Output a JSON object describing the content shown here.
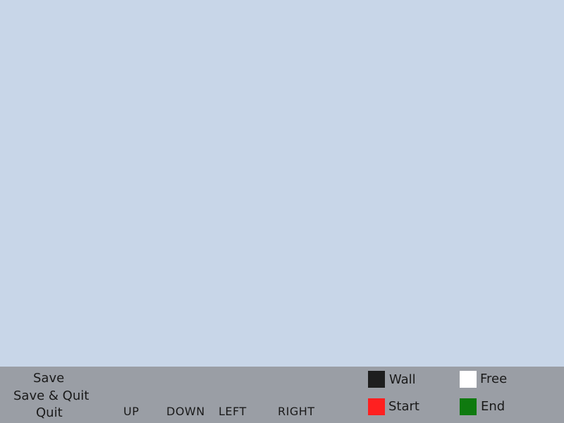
{
  "colors": {
    "canvas_background": "#c8d6e8",
    "toolbar_background": "#9a9ea5",
    "wall": "#1e1e1e",
    "free": "#ffffff",
    "start": "#ff2020",
    "end": "#0f7a0f"
  },
  "menu": {
    "save": "Save",
    "save_quit": "Save & Quit",
    "quit": "Quit"
  },
  "directions": {
    "up": "UP",
    "down": "DOWN",
    "left": "LEFT",
    "right": "RIGHT"
  },
  "legend": {
    "wall": "Wall",
    "free": "Free",
    "start": "Start",
    "end": "End"
  }
}
